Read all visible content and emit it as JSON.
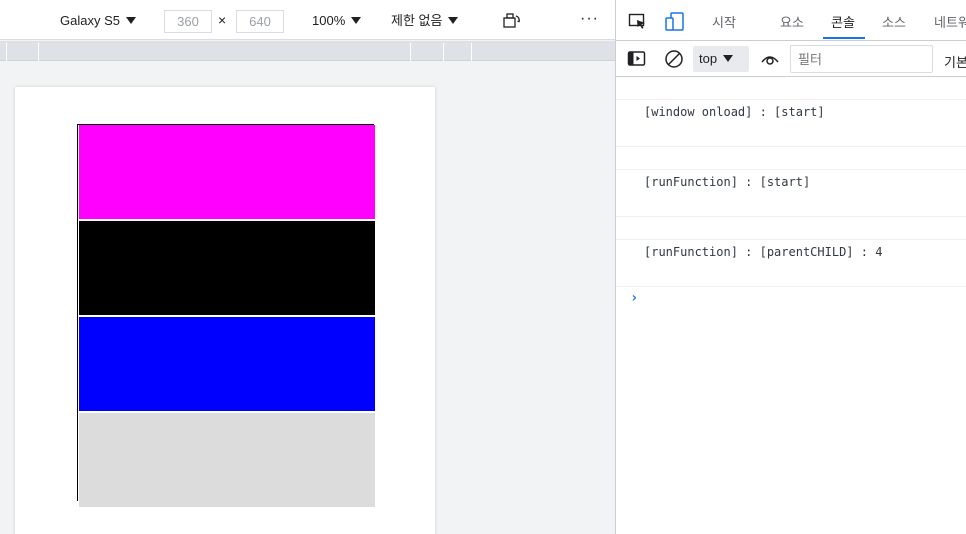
{
  "device_toolbar": {
    "device": "Galaxy S5",
    "width": "360",
    "times": "×",
    "height": "640",
    "zoom": "100%",
    "throttle": "제한 없음",
    "more": "···"
  },
  "page": {
    "children": [
      {
        "color": "#ff00ff"
      },
      {
        "color": "#000000"
      },
      {
        "color": "#0000ff"
      },
      {
        "color": "#dcdcdc"
      }
    ]
  },
  "devtools": {
    "tabs": [
      {
        "label": "시작"
      },
      {
        "label": "요소"
      },
      {
        "label": "콘솔",
        "active": true
      },
      {
        "label": "소스"
      },
      {
        "label": "네트워"
      }
    ],
    "accent": "#1a73e8",
    "console_toolbar": {
      "context": "top",
      "filter_placeholder": "필터",
      "levels": "기본"
    },
    "console_lines": [
      {
        "text": "[window onload] : [start]"
      },
      {
        "text": "[runFunction] : [start]"
      },
      {
        "text": "[runFunction] : [parentCHILD] : 4"
      }
    ],
    "prompt": "›"
  }
}
